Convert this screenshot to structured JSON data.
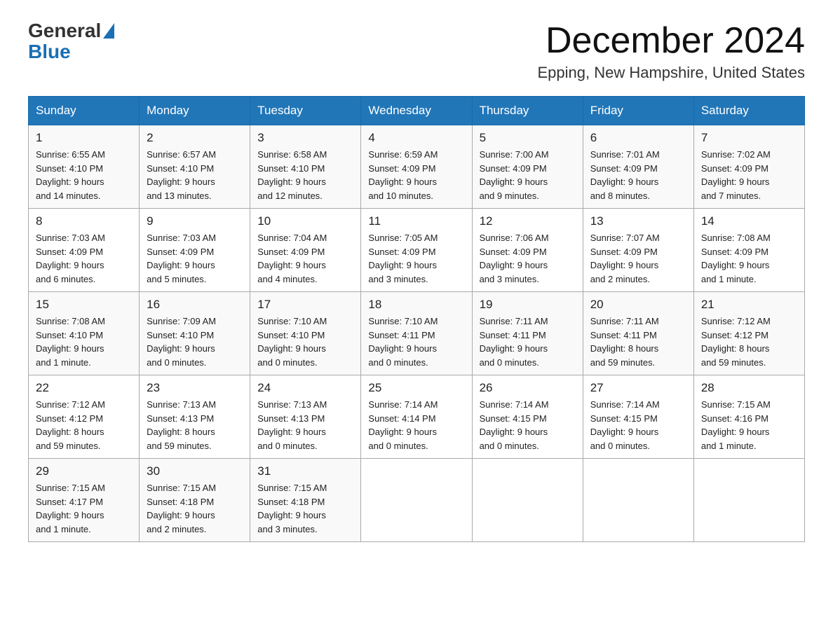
{
  "header": {
    "logo_general": "General",
    "logo_blue": "Blue",
    "month_title": "December 2024",
    "location": "Epping, New Hampshire, United States"
  },
  "days_of_week": [
    "Sunday",
    "Monday",
    "Tuesday",
    "Wednesday",
    "Thursday",
    "Friday",
    "Saturday"
  ],
  "weeks": [
    [
      {
        "day": "1",
        "sunrise": "6:55 AM",
        "sunset": "4:10 PM",
        "daylight": "9 hours and 14 minutes."
      },
      {
        "day": "2",
        "sunrise": "6:57 AM",
        "sunset": "4:10 PM",
        "daylight": "9 hours and 13 minutes."
      },
      {
        "day": "3",
        "sunrise": "6:58 AM",
        "sunset": "4:10 PM",
        "daylight": "9 hours and 12 minutes."
      },
      {
        "day": "4",
        "sunrise": "6:59 AM",
        "sunset": "4:09 PM",
        "daylight": "9 hours and 10 minutes."
      },
      {
        "day": "5",
        "sunrise": "7:00 AM",
        "sunset": "4:09 PM",
        "daylight": "9 hours and 9 minutes."
      },
      {
        "day": "6",
        "sunrise": "7:01 AM",
        "sunset": "4:09 PM",
        "daylight": "9 hours and 8 minutes."
      },
      {
        "day": "7",
        "sunrise": "7:02 AM",
        "sunset": "4:09 PM",
        "daylight": "9 hours and 7 minutes."
      }
    ],
    [
      {
        "day": "8",
        "sunrise": "7:03 AM",
        "sunset": "4:09 PM",
        "daylight": "9 hours and 6 minutes."
      },
      {
        "day": "9",
        "sunrise": "7:03 AM",
        "sunset": "4:09 PM",
        "daylight": "9 hours and 5 minutes."
      },
      {
        "day": "10",
        "sunrise": "7:04 AM",
        "sunset": "4:09 PM",
        "daylight": "9 hours and 4 minutes."
      },
      {
        "day": "11",
        "sunrise": "7:05 AM",
        "sunset": "4:09 PM",
        "daylight": "9 hours and 3 minutes."
      },
      {
        "day": "12",
        "sunrise": "7:06 AM",
        "sunset": "4:09 PM",
        "daylight": "9 hours and 3 minutes."
      },
      {
        "day": "13",
        "sunrise": "7:07 AM",
        "sunset": "4:09 PM",
        "daylight": "9 hours and 2 minutes."
      },
      {
        "day": "14",
        "sunrise": "7:08 AM",
        "sunset": "4:09 PM",
        "daylight": "9 hours and 1 minute."
      }
    ],
    [
      {
        "day": "15",
        "sunrise": "7:08 AM",
        "sunset": "4:10 PM",
        "daylight": "9 hours and 1 minute."
      },
      {
        "day": "16",
        "sunrise": "7:09 AM",
        "sunset": "4:10 PM",
        "daylight": "9 hours and 0 minutes."
      },
      {
        "day": "17",
        "sunrise": "7:10 AM",
        "sunset": "4:10 PM",
        "daylight": "9 hours and 0 minutes."
      },
      {
        "day": "18",
        "sunrise": "7:10 AM",
        "sunset": "4:11 PM",
        "daylight": "9 hours and 0 minutes."
      },
      {
        "day": "19",
        "sunrise": "7:11 AM",
        "sunset": "4:11 PM",
        "daylight": "9 hours and 0 minutes."
      },
      {
        "day": "20",
        "sunrise": "7:11 AM",
        "sunset": "4:11 PM",
        "daylight": "8 hours and 59 minutes."
      },
      {
        "day": "21",
        "sunrise": "7:12 AM",
        "sunset": "4:12 PM",
        "daylight": "8 hours and 59 minutes."
      }
    ],
    [
      {
        "day": "22",
        "sunrise": "7:12 AM",
        "sunset": "4:12 PM",
        "daylight": "8 hours and 59 minutes."
      },
      {
        "day": "23",
        "sunrise": "7:13 AM",
        "sunset": "4:13 PM",
        "daylight": "8 hours and 59 minutes."
      },
      {
        "day": "24",
        "sunrise": "7:13 AM",
        "sunset": "4:13 PM",
        "daylight": "9 hours and 0 minutes."
      },
      {
        "day": "25",
        "sunrise": "7:14 AM",
        "sunset": "4:14 PM",
        "daylight": "9 hours and 0 minutes."
      },
      {
        "day": "26",
        "sunrise": "7:14 AM",
        "sunset": "4:15 PM",
        "daylight": "9 hours and 0 minutes."
      },
      {
        "day": "27",
        "sunrise": "7:14 AM",
        "sunset": "4:15 PM",
        "daylight": "9 hours and 0 minutes."
      },
      {
        "day": "28",
        "sunrise": "7:15 AM",
        "sunset": "4:16 PM",
        "daylight": "9 hours and 1 minute."
      }
    ],
    [
      {
        "day": "29",
        "sunrise": "7:15 AM",
        "sunset": "4:17 PM",
        "daylight": "9 hours and 1 minute."
      },
      {
        "day": "30",
        "sunrise": "7:15 AM",
        "sunset": "4:18 PM",
        "daylight": "9 hours and 2 minutes."
      },
      {
        "day": "31",
        "sunrise": "7:15 AM",
        "sunset": "4:18 PM",
        "daylight": "9 hours and 3 minutes."
      },
      null,
      null,
      null,
      null
    ]
  ],
  "labels": {
    "sunrise": "Sunrise:",
    "sunset": "Sunset:",
    "daylight": "Daylight:"
  }
}
